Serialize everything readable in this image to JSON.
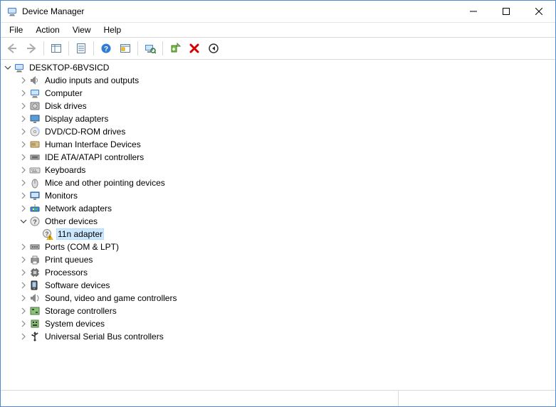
{
  "window": {
    "title": "Device Manager"
  },
  "menu": {
    "items": [
      "File",
      "Action",
      "View",
      "Help"
    ]
  },
  "toolbar": {
    "icons": [
      "back",
      "forward",
      "show-hide-console",
      "properties",
      "help",
      "scan-hardware",
      "update-driver",
      "uninstall",
      "delete",
      "enable-device"
    ]
  },
  "tree": {
    "root": {
      "label": "DESKTOP-6BVSICD",
      "expanded": true,
      "icon": "computer",
      "children": [
        {
          "label": "Audio inputs and outputs",
          "icon": "audio",
          "hasChildren": true
        },
        {
          "label": "Computer",
          "icon": "computer",
          "hasChildren": true
        },
        {
          "label": "Disk drives",
          "icon": "disk",
          "hasChildren": true
        },
        {
          "label": "Display adapters",
          "icon": "display",
          "hasChildren": true
        },
        {
          "label": "DVD/CD-ROM drives",
          "icon": "dvd",
          "hasChildren": true
        },
        {
          "label": "Human Interface Devices",
          "icon": "hid",
          "hasChildren": true
        },
        {
          "label": "IDE ATA/ATAPI controllers",
          "icon": "ide",
          "hasChildren": true
        },
        {
          "label": "Keyboards",
          "icon": "keyboard",
          "hasChildren": true
        },
        {
          "label": "Mice and other pointing devices",
          "icon": "mouse",
          "hasChildren": true
        },
        {
          "label": "Monitors",
          "icon": "monitor",
          "hasChildren": true
        },
        {
          "label": "Network adapters",
          "icon": "network",
          "hasChildren": true
        },
        {
          "label": "Other devices",
          "icon": "other",
          "expanded": true,
          "hasChildren": true,
          "children": [
            {
              "label": "11n adapter",
              "icon": "unknown-warning",
              "selected": true
            }
          ]
        },
        {
          "label": "Ports (COM & LPT)",
          "icon": "port",
          "hasChildren": true
        },
        {
          "label": "Print queues",
          "icon": "printer",
          "hasChildren": true
        },
        {
          "label": "Processors",
          "icon": "cpu",
          "hasChildren": true
        },
        {
          "label": "Software devices",
          "icon": "software",
          "hasChildren": true
        },
        {
          "label": "Sound, video and game controllers",
          "icon": "sound",
          "hasChildren": true
        },
        {
          "label": "Storage controllers",
          "icon": "storage",
          "hasChildren": true
        },
        {
          "label": "System devices",
          "icon": "system",
          "hasChildren": true
        },
        {
          "label": "Universal Serial Bus controllers",
          "icon": "usb",
          "hasChildren": true
        }
      ]
    }
  }
}
